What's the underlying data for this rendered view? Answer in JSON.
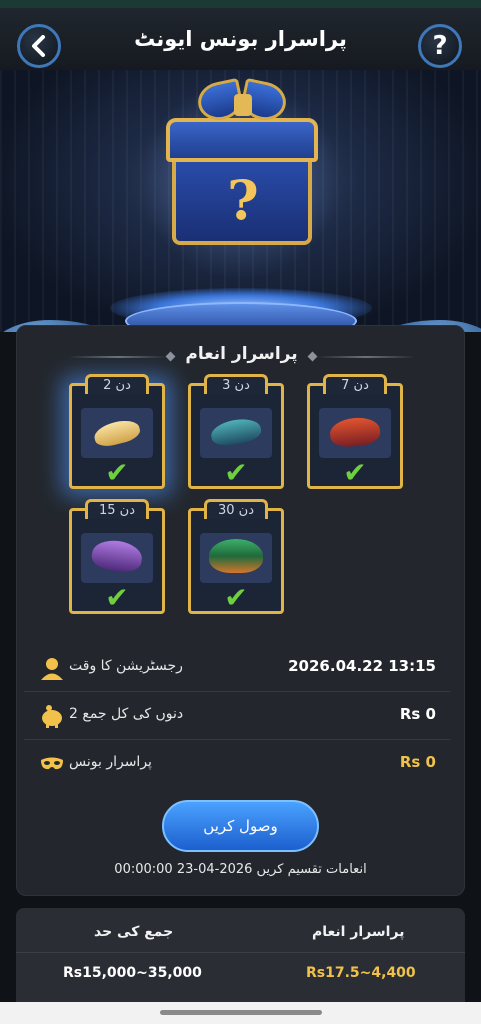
{
  "header": {
    "title": "پراسرار بونس ایونٹ",
    "back_icon": "chevron-left-icon",
    "help_label": "?"
  },
  "rewards_section": {
    "title": "پراسرار انعام",
    "cards": [
      {
        "day_label": "دن 2",
        "item": "gold-mask",
        "claimed": true,
        "highlighted": true
      },
      {
        "day_label": "دن 3",
        "item": "teal-mask",
        "claimed": true,
        "highlighted": false
      },
      {
        "day_label": "دن 7",
        "item": "red-mask",
        "claimed": true,
        "highlighted": false
      },
      {
        "day_label": "دن 15",
        "item": "purple-mask",
        "claimed": true,
        "highlighted": false
      },
      {
        "day_label": "دن 30",
        "item": "green-hat-mask",
        "claimed": true,
        "highlighted": false
      }
    ],
    "check_mark": "✔"
  },
  "info": {
    "registration_label": "رجسٹریشن کا وقت",
    "registration_value": "2026.04.22 13:15",
    "total_deposit_label": "دنوں کی کل جمع 2",
    "total_deposit_value": "Rs 0",
    "mystery_bonus_label": "پراسرار بونس",
    "mystery_bonus_value": "Rs 0"
  },
  "claim_button": "وصول کریں",
  "distribution_text": "انعامات تقسیم کریں 2026-04-23 00:00:00",
  "table": {
    "headers": [
      "جمع کی حد",
      "پراسرار انعام"
    ],
    "rows": [
      [
        "Rs15,000~35,000",
        "Rs17.5~4,400"
      ]
    ]
  },
  "colors": {
    "accent_gold": "#f1c24a",
    "button_blue": "#2e7be6",
    "check_green": "#6fcf3f"
  }
}
